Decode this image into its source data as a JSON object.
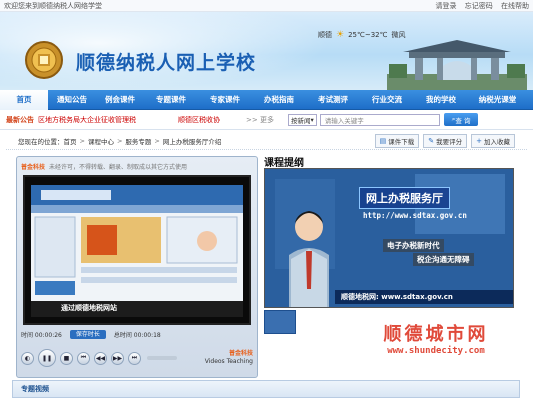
{
  "top": {
    "welcome": "欢迎您来到顺德纳税人网络学堂",
    "links": [
      "请登录",
      "忘记密码",
      "在线帮助"
    ]
  },
  "header": {
    "site_title": "顺德纳税人网上学校",
    "weather": {
      "city": "顺德",
      "temp": "25℃~32℃",
      "condition": "微风"
    }
  },
  "nav": {
    "items": [
      "首页",
      "通知公告",
      "例会课件",
      "专题课件",
      "专家课件",
      "办税指南",
      "考试测评",
      "行业交流",
      "我的学校",
      "纳税光课堂"
    ],
    "active_index": 0
  },
  "notice": {
    "label": "最新公告",
    "text1": "区地方税务局大企业征收管理税",
    "text2": "顺德区税收协",
    "more": ">> 更多",
    "search_scope": "按新闻",
    "search_placeholder": "请输入关键字",
    "search_button": "查 询"
  },
  "breadcrumb": {
    "prefix": "您现在的位置：",
    "items": [
      "首页",
      "课程中心",
      "服务专题",
      "网上办税服务厅介绍"
    ]
  },
  "actions": [
    "课件下载",
    "我要评分",
    "加入收藏"
  ],
  "player": {
    "brand": "普金科技",
    "notice": "未经许可，不得转载、翻录、制取成以其它方式使用",
    "time_current": "时间 00:00:26",
    "time_total": "总时间 00:00:18",
    "save_label": "保存时长",
    "ctrl_brand_cn": "普金科技",
    "ctrl_brand_en": "Videos Teaching",
    "screen_caption": "通过顺德地税网站"
  },
  "lesson": {
    "title": "课程提纲",
    "video_title": "网上办税服务厅",
    "video_url": "http://www.sdtax.gov.cn",
    "subtitle1": "电子办税新时代",
    "subtitle2": "税企沟通无障碍",
    "caption": "顺德地税网: www.sdtax.gov.cn"
  },
  "watermark": {
    "cn": "顺德城市网",
    "url": "www.shundecity.com"
  },
  "section": {
    "title": "专题视频"
  },
  "colors": {
    "nav": "#1e6ec8",
    "accent": "#e04a3a"
  }
}
